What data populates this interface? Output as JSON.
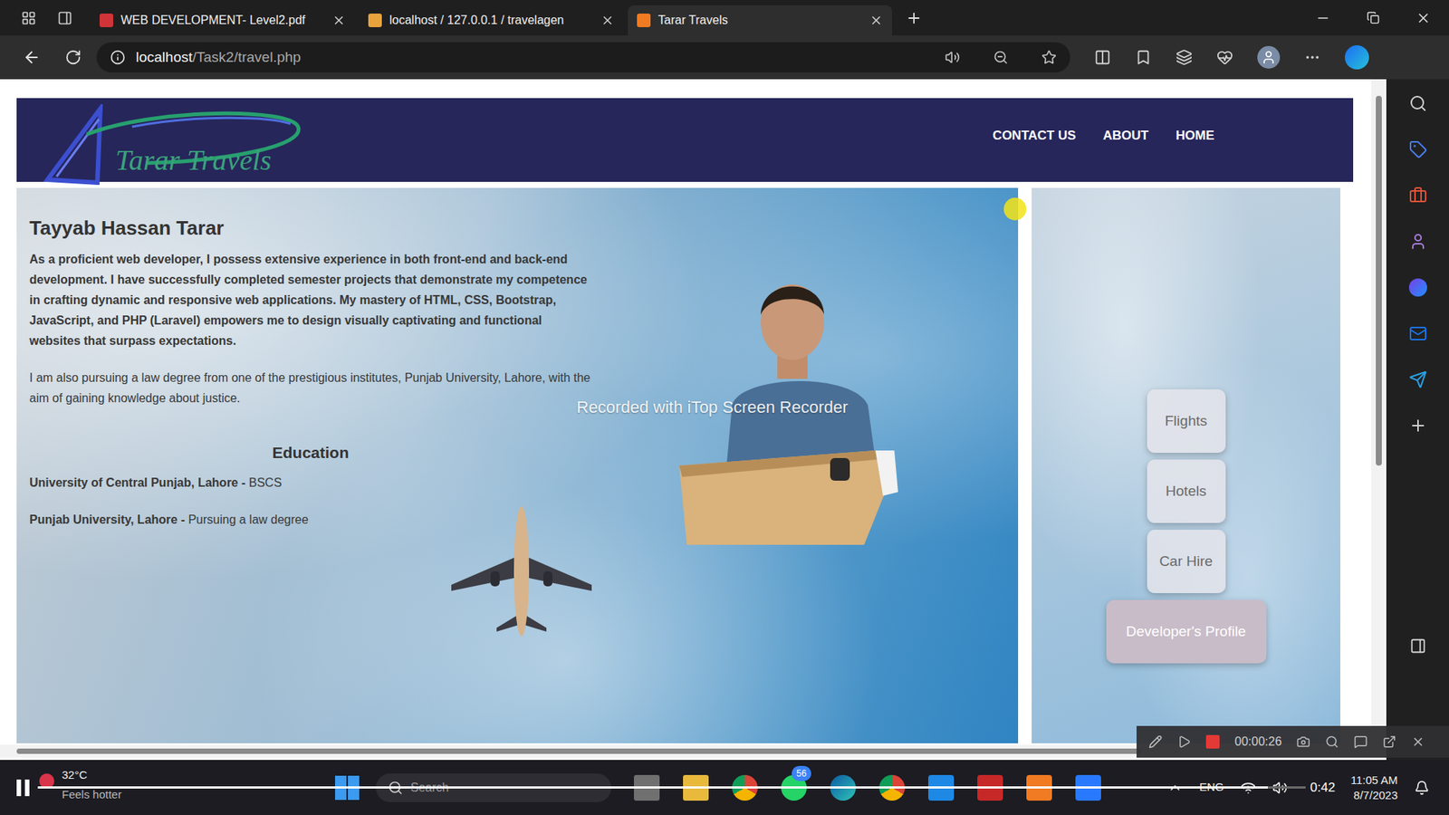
{
  "browser": {
    "tabs": [
      {
        "label": "WEB DEVELOPMENT- Level2.pdf",
        "selected": false
      },
      {
        "label": "localhost / 127.0.0.1 / travelagen",
        "selected": false
      },
      {
        "label": "Tarar Travels",
        "selected": true
      }
    ],
    "address": {
      "host": "localhost",
      "path": "/Task2/travel.php"
    }
  },
  "site": {
    "logo": "Tarar Travels",
    "nav": [
      {
        "label": "CONTACT US"
      },
      {
        "label": "ABOUT"
      },
      {
        "label": "HOME"
      }
    ],
    "profile": {
      "name": "Tayyab Hassan Tarar",
      "paragraphs": [
        {
          "text": "As a proficient web developer, I possess extensive experience in both front-end and back-end development. I have successfully completed semester projects that demonstrate my competence in crafting dynamic and responsive web applications. My mastery of HTML, CSS, Bootstrap, JavaScript, and PHP (Laravel) empowers me to design visually captivating and functional websites that surpass expectations.",
          "bold": true
        },
        {
          "text": "I am also pursuing a law degree from one of the prestigious institutes, Punjab University, Lahore, with the aim of gaining knowledge about justice.",
          "bold": false
        }
      ],
      "education_title": "Education",
      "education": [
        {
          "school": "University of Central Punjab, Lahore -",
          "degree": "BSCS"
        },
        {
          "school": "Punjab University, Lahore -",
          "degree": "Pursuing a law degree"
        }
      ]
    },
    "side_buttons": [
      {
        "label": "Flights",
        "kind": "plain"
      },
      {
        "label": "Hotels",
        "kind": "plain"
      },
      {
        "label": "Car Hire",
        "kind": "plain"
      },
      {
        "label": "Developer's Profile",
        "kind": "primary"
      }
    ]
  },
  "watermark": "Recorded with iTop Screen Recorder",
  "recorder": {
    "time": "00:00:26",
    "recording": true
  },
  "taskbar": {
    "weather": {
      "temp": "32°C",
      "note": "Feels hotter"
    },
    "search": "Search",
    "whatsapp_badge": "56",
    "lang": "ENG",
    "time": "11:05 AM",
    "date": "8/7/2023"
  },
  "player": {
    "time": "0:42",
    "playing": true,
    "level": 0.97
  }
}
